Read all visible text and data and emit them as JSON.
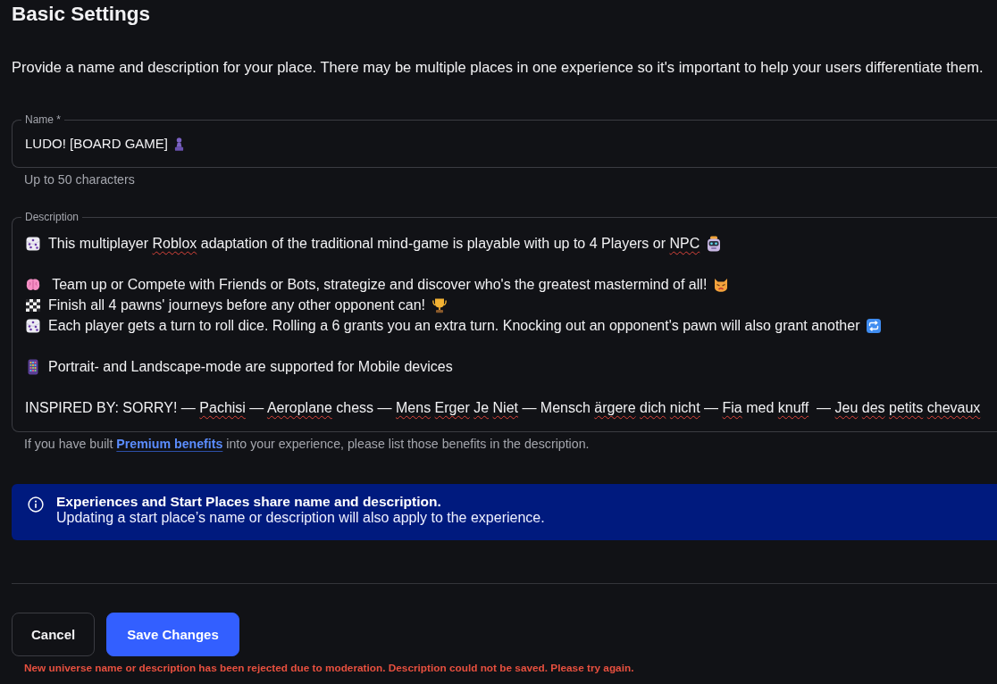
{
  "page": {
    "title": "Basic Settings",
    "intro": "Provide a name and description for your place. There may be multiple places in one experience so it's important to help your users differentiate them."
  },
  "name_field": {
    "label": "Name *",
    "parts": [
      {
        "kind": "text",
        "text": "LUDO! [BOARD GAME]",
        "misspelled": false
      },
      {
        "kind": "pawn"
      }
    ],
    "hint": "Up to 50 characters"
  },
  "description_field": {
    "label": "Description",
    "paragraphs": [
      {
        "lines": [
          {
            "parts": [
              {
                "kind": "dice"
              },
              {
                "kind": "text",
                "text": "This multiplayer ",
                "misspelled": false
              },
              {
                "kind": "text",
                "text": "Roblox",
                "misspelled": true
              },
              {
                "kind": "text",
                "text": " adaptation of the traditional mind-game is playable with up to 4 Players or ",
                "misspelled": false
              },
              {
                "kind": "text",
                "text": "NPC",
                "misspelled": true
              },
              {
                "kind": "robot"
              }
            ]
          }
        ]
      },
      {
        "lines": [
          {
            "parts": [
              {
                "kind": "brain"
              },
              {
                "kind": "text",
                "text": " Team up or Compete with Friends or Bots, strategize and discover who's the greatest mastermind of all!",
                "misspelled": false
              },
              {
                "kind": "cat"
              }
            ]
          },
          {
            "parts": [
              {
                "kind": "checkered"
              },
              {
                "kind": "text",
                "text": "Finish all 4 pawns' journeys before any other opponent can!",
                "misspelled": false
              },
              {
                "kind": "trophy"
              }
            ]
          },
          {
            "parts": [
              {
                "kind": "dice"
              },
              {
                "kind": "text",
                "text": "Each player gets a turn to roll dice. Rolling a 6 grants you an extra turn. Knocking out an opponent's pawn will also grant another",
                "misspelled": false
              },
              {
                "kind": "repeat"
              }
            ]
          }
        ]
      },
      {
        "lines": [
          {
            "parts": [
              {
                "kind": "phone"
              },
              {
                "kind": "text",
                "text": "Portrait- and Landscape-mode are supported for Mobile devices",
                "misspelled": false
              }
            ]
          }
        ]
      },
      {
        "lines": [
          {
            "parts": [
              {
                "kind": "text",
                "text": "INSPIRED BY: SORRY! — ",
                "misspelled": false
              },
              {
                "kind": "text",
                "text": "Pachisi",
                "misspelled": true
              },
              {
                "kind": "text",
                "text": " — ",
                "misspelled": false
              },
              {
                "kind": "text",
                "text": "Aeroplane",
                "misspelled": true
              },
              {
                "kind": "text",
                "text": " chess — ",
                "misspelled": false
              },
              {
                "kind": "text",
                "text": "Mens Erger Je Niet",
                "misspelled": true
              },
              {
                "kind": "text",
                "text": " — Mensch ",
                "misspelled": false
              },
              {
                "kind": "text",
                "text": "ärgere dich nicht",
                "misspelled": true
              },
              {
                "kind": "text",
                "text": " — ",
                "misspelled": false
              },
              {
                "kind": "text",
                "text": "Fia",
                "misspelled": true
              },
              {
                "kind": "text",
                "text": " med ",
                "misspelled": false
              },
              {
                "kind": "text",
                "text": "knuff",
                "misspelled": true
              },
              {
                "kind": "text",
                "text": "  — ",
                "misspelled": false
              },
              {
                "kind": "text",
                "text": "Jeu des petits chevaux",
                "misspelled": true
              }
            ]
          }
        ]
      }
    ],
    "help": {
      "before": "If you have built ",
      "link": "Premium benefits",
      "after": " into your experience, please list those benefits in the description."
    }
  },
  "notice": {
    "title": "Experiences and Start Places share name and description.",
    "body": "Updating a start place’s name or description will also apply to the experience."
  },
  "buttons": [
    {
      "kind": "secondary",
      "label": "Cancel"
    },
    {
      "kind": "primary",
      "label": "Save Changes"
    }
  ],
  "error": "New universe name or description has been rejected due to moderation. Description could not be saved. Please try again."
}
